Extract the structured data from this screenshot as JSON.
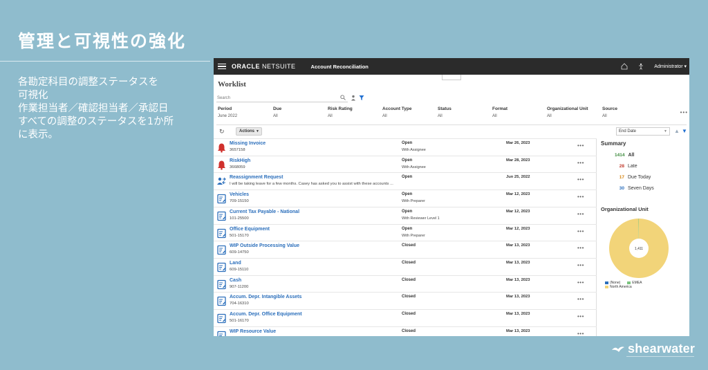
{
  "slide": {
    "title": "管理と可視性の強化",
    "lines": [
      "各勘定科目の調整ステータスを",
      "可視化",
      "作業担当者／確認担当者／承認日",
      "すべての調整のステータスを1か所",
      "に表示。"
    ],
    "brand": "shearwater"
  },
  "app": {
    "logo_oracle": "ORACLE",
    "logo_netsuite": "NETSUITE",
    "app_name": "Account Reconciliation",
    "user_role": "Administrator ▾",
    "page_title": "Worklist",
    "search_placeholder": "Search",
    "filters": [
      {
        "label": "Period",
        "value": "June 2022"
      },
      {
        "label": "Due",
        "value": "All"
      },
      {
        "label": "Risk Rating",
        "value": "All"
      },
      {
        "label": "Account Type",
        "value": "All"
      },
      {
        "label": "Status",
        "value": "All"
      },
      {
        "label": "Format",
        "value": "All"
      },
      {
        "label": "Organizational Unit",
        "value": "All"
      },
      {
        "label": "Source",
        "value": "All"
      }
    ],
    "actions_label": "Actions",
    "sort_label": "End Date",
    "rows": [
      {
        "icon": "bell-icon",
        "name": "Missing Invoice",
        "id": "3657158",
        "status": "Open",
        "sub": "With Assignee",
        "date": "Mar 26, 2023"
      },
      {
        "icon": "bell-icon",
        "name": "RiskHigh",
        "id": "3668059",
        "status": "Open",
        "sub": "With Assignee",
        "date": "Mar 28, 2023"
      },
      {
        "icon": "people-icon",
        "name": "Reassignment Request",
        "id": "I will be taking leave for a few months. Casey has asked you to assist with these accounts ...",
        "status": "Open",
        "sub": "",
        "date": "Jun 25, 2022"
      },
      {
        "icon": "doc-icon",
        "name": "Vehicles",
        "id": "709-15150",
        "status": "Open",
        "sub": "With Preparer",
        "date": "Mar 12, 2023"
      },
      {
        "icon": "doc-icon",
        "name": "Current Tax Payable - National",
        "id": "101-25500",
        "status": "Open",
        "sub": "With Reviewer Level 1",
        "date": "Mar 12, 2023"
      },
      {
        "icon": "doc-icon",
        "name": "Office Equipment",
        "id": "501-15170",
        "status": "Open",
        "sub": "With Preparer",
        "date": "Mar 12, 2023"
      },
      {
        "icon": "doc-icon",
        "name": "WIP Outside Processing Value",
        "id": "609-14750",
        "status": "Closed",
        "sub": "",
        "date": "Mar 13, 2023"
      },
      {
        "icon": "doc-icon",
        "name": "Land",
        "id": "609-15110",
        "status": "Closed",
        "sub": "",
        "date": "Mar 13, 2023"
      },
      {
        "icon": "doc-icon",
        "name": "Cash",
        "id": "907-11200",
        "status": "Closed",
        "sub": "",
        "date": "Mar 13, 2023"
      },
      {
        "icon": "doc-icon",
        "name": "Accum. Depr. Intangible Assets",
        "id": "704-16310",
        "status": "Closed",
        "sub": "",
        "date": "Mar 13, 2023"
      },
      {
        "icon": "doc-icon",
        "name": "Accum. Depr. Office Equipment",
        "id": "501-16170",
        "status": "Closed",
        "sub": "",
        "date": "Mar 13, 2023"
      },
      {
        "icon": "doc-icon",
        "name": "WIP Resource Value",
        "id": "",
        "status": "Closed",
        "sub": "",
        "date": "Mar 13, 2023"
      }
    ],
    "summary": {
      "title": "Summary",
      "items": [
        {
          "count": "1414",
          "label": "All",
          "color": "#3c8a3c"
        },
        {
          "count": "28",
          "label": "Late",
          "color": "#c0392b"
        },
        {
          "count": "17",
          "label": "Due Today",
          "color": "#d4820e"
        },
        {
          "count": "30",
          "label": "Seven Days",
          "color": "#2a6ebb"
        }
      ]
    },
    "org_unit": {
      "title": "Organizational Unit",
      "center_label": "1,411",
      "legend": [
        {
          "label": "(None)",
          "color": "#2a6ebb"
        },
        {
          "label": "EMEA",
          "color": "#7bc47f"
        },
        {
          "label": "North America",
          "color": "#f2d479"
        }
      ]
    }
  },
  "chart_data": {
    "type": "pie",
    "categories": [
      "North America",
      "EMEA",
      "(None)"
    ],
    "values": [
      1411,
      3,
      0
    ]
  }
}
